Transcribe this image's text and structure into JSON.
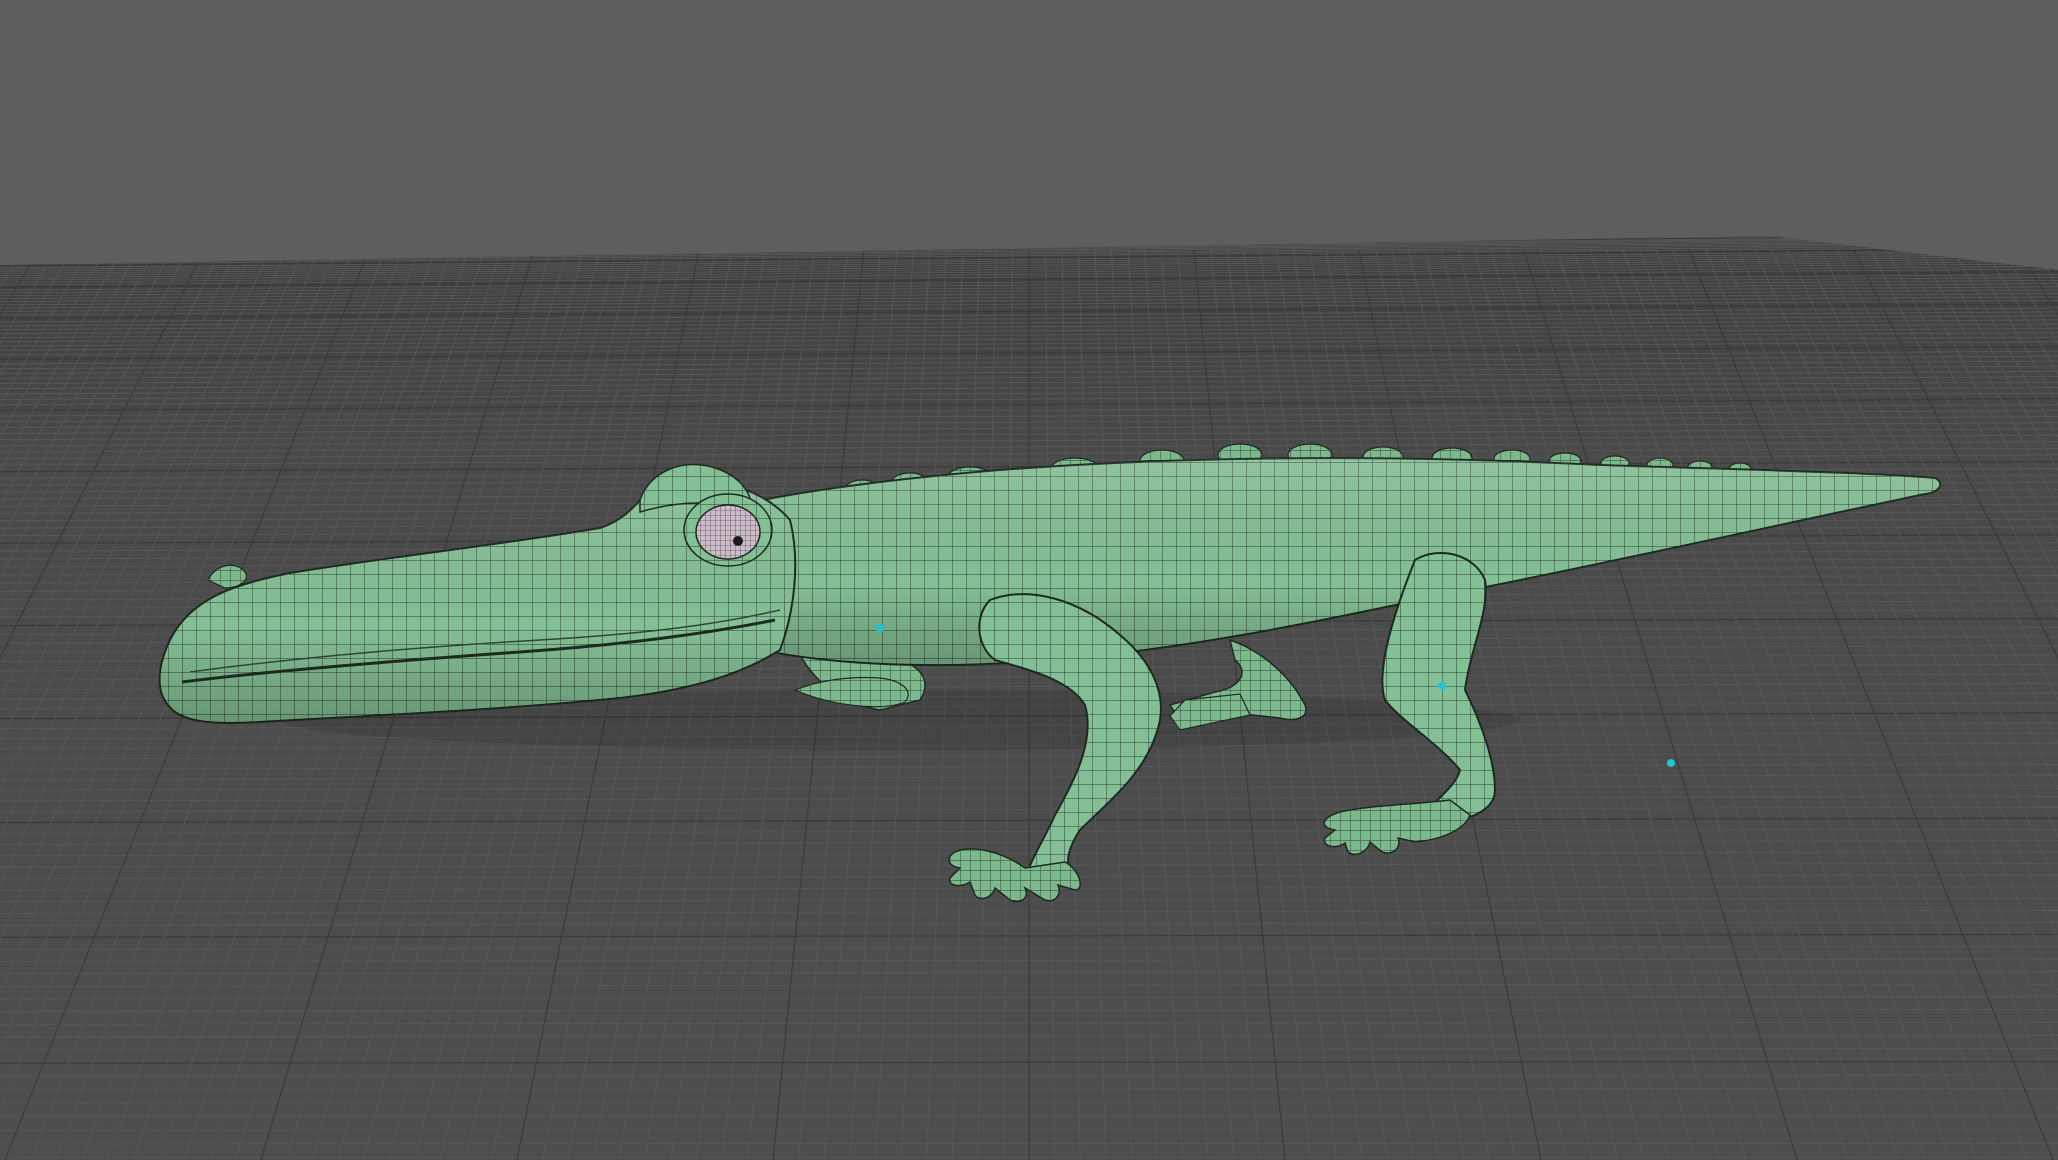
{
  "viewport": {
    "type": "3d-modeling-viewport",
    "background_color": "#5e5e5e",
    "ground_color": "#4b4b4b",
    "grid_line_color": "#5a5a5a",
    "grid_major_color": "#3a3a3a",
    "mesh_color": "#84c095",
    "mesh_shade_color": "#6ea67d",
    "wire_color": "#1d2a20",
    "eye_color": "#c9b9c6",
    "locator_color": "#1ec4d6"
  },
  "model": {
    "name_icon": "alligator-mesh-icon",
    "parts": [
      "head",
      "jaw",
      "eye",
      "nostril",
      "body",
      "back-ridges",
      "tail",
      "front-leg-near",
      "front-leg-far",
      "rear-leg-near",
      "rear-leg-far"
    ]
  },
  "locators": [
    "locator-1",
    "locator-2",
    "locator-3"
  ]
}
